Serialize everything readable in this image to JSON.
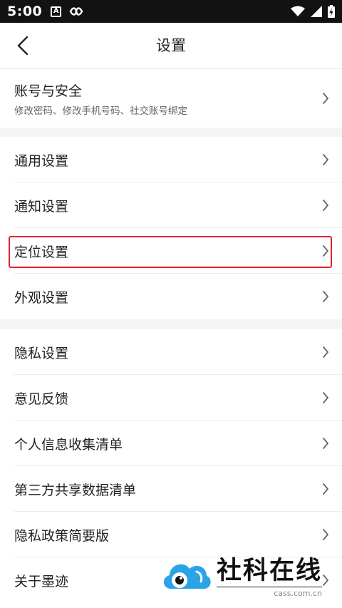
{
  "status_bar": {
    "time": "5:00",
    "a_icon_letter": "A"
  },
  "header": {
    "title": "设置"
  },
  "groups": [
    {
      "rows": [
        {
          "label": "账号与安全",
          "sub": "修改密码、修改手机号码、社交账号绑定"
        }
      ]
    },
    {
      "rows": [
        {
          "label": "通用设置"
        },
        {
          "label": "通知设置"
        },
        {
          "label": "定位设置"
        },
        {
          "label": "外观设置"
        }
      ]
    },
    {
      "rows": [
        {
          "label": "隐私设置"
        },
        {
          "label": "意见反馈"
        },
        {
          "label": "个人信息收集清单"
        },
        {
          "label": "第三方共享数据清单"
        },
        {
          "label": "隐私政策简要版"
        },
        {
          "label": "关于墨迹"
        }
      ]
    }
  ],
  "highlight_color": "#e0242b",
  "watermark": {
    "title": "社科在线",
    "url": "cass.com.cn"
  }
}
